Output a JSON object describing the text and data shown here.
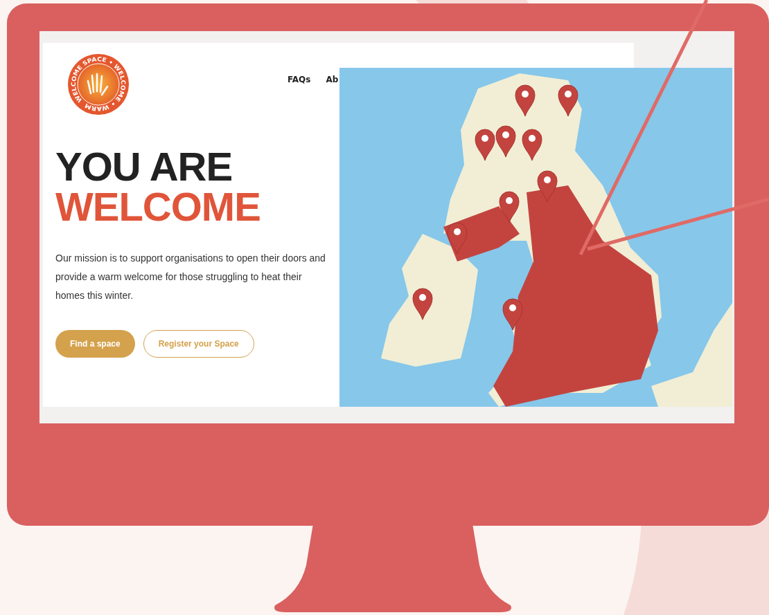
{
  "logo": {
    "ring_text": "WELCOME SPACE • WELCOME • WARM"
  },
  "nav": [
    {
      "label": "FAQs"
    },
    {
      "label": "Ab"
    }
  ],
  "hero": {
    "heading_line_1": "YOU ARE",
    "heading_line_2": "WELCOME",
    "text": "Our mission is to support organisations to open their doors and provide a warm welcome for those struggling to heat their homes this winter.",
    "buttons": [
      {
        "label": "Find a space",
        "kind": "filled"
      },
      {
        "label": "Register your Space",
        "kind": "outline"
      }
    ]
  }
}
